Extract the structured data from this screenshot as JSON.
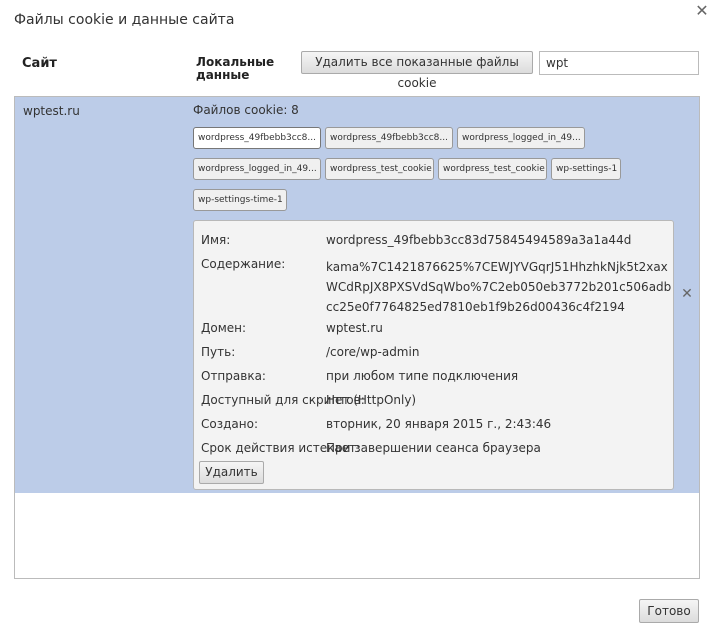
{
  "dialog": {
    "title": "Файлы cookie и данные сайта"
  },
  "header": {
    "site_col": "Сайт",
    "local_col": "Локальные данные",
    "delete_all_label": "Удалить все показанные файлы cookie",
    "search_value": "wpt"
  },
  "site": {
    "name": "wptest.ru",
    "cookie_count": "Файлов cookie: 8",
    "chips": [
      "wordpress_49fbebb3cc8...",
      "wordpress_49fbebb3cc8...",
      "wordpress_logged_in_49...",
      "wordpress_logged_in_49...",
      "wordpress_test_cookie",
      "wordpress_test_cookie",
      "wp-settings-1",
      "wp-settings-time-1"
    ]
  },
  "detail": {
    "name_label": "Имя:",
    "name_value": "wordpress_49fbebb3cc83d75845494589a3a1a44d",
    "content_label": "Содержание:",
    "content_value": "kama%7C1421876625%7CEWJYVGqrJ51HhzhkNjk5t2xaxWCdRpJX8PXSVdSqWbo%7C2eb050eb3772b201c506adbcc25e0f7764825ed7810eb1f9b26d00436c4f2194",
    "domain_label": "Домен:",
    "domain_value": "wptest.ru",
    "path_label": "Путь:",
    "path_value": "/core/wp-admin",
    "send_label": "Отправка:",
    "send_value": "при любом типе подключения",
    "script_label": "Доступный для скриптов:",
    "script_value": "Нет (HttpOnly)",
    "created_label": "Создано:",
    "created_value": "вторник, 20 января 2015 г., 2:43:46",
    "expires_label": "Срок действия истекает:",
    "expires_value": "При завершении сеанса браузера",
    "delete_label": "Удалить"
  },
  "footer": {
    "done_label": "Готово"
  },
  "icons": {
    "close": "close-icon",
    "remove": "remove-icon"
  },
  "colors": {
    "selected_row": "#bccce8",
    "detail_bg": "#f3f3f3"
  }
}
